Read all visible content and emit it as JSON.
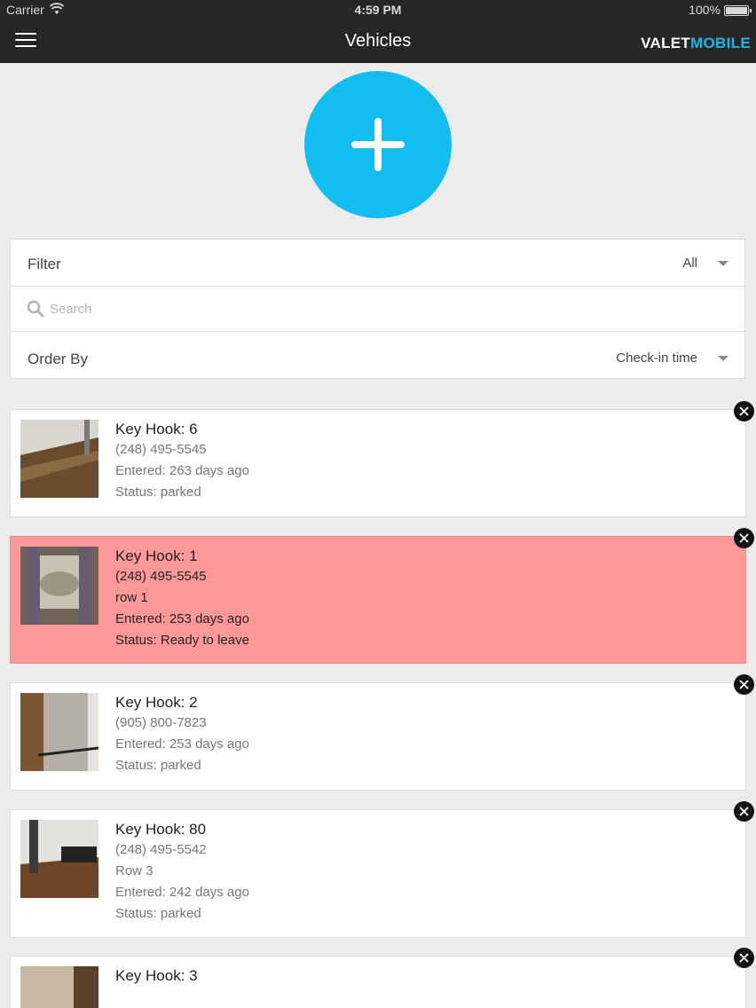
{
  "status_bar": {
    "carrier": "Carrier",
    "time": "4:59 PM",
    "battery": "100%"
  },
  "nav": {
    "title": "Vehicles",
    "brand_part1": "VALET",
    "brand_part2": "MOBILE",
    "brand_accent_color": "#16b9e8"
  },
  "add_button": {
    "color": "#12bdf0",
    "icon": "plus-icon"
  },
  "filter": {
    "label": "Filter",
    "value": "All"
  },
  "search": {
    "placeholder": "Search"
  },
  "order_by": {
    "label": "Order By",
    "value": "Check-in time"
  },
  "vehicles": [
    {
      "key_hook": "Key Hook: 6",
      "phone": "(248) 495-5545",
      "note": "",
      "entered": "Entered: 263 days ago",
      "status": "Status: parked",
      "highlight": false
    },
    {
      "key_hook": "Key Hook: 1",
      "phone": "(248) 495-5545",
      "note": "row 1",
      "entered": "Entered: 253 days ago",
      "status": "Status: Ready to leave",
      "highlight": true
    },
    {
      "key_hook": "Key Hook: 2",
      "phone": "(905) 800-7823",
      "note": "",
      "entered": "Entered: 253 days ago",
      "status": "Status: parked",
      "highlight": false
    },
    {
      "key_hook": "Key Hook: 80",
      "phone": "(248) 495-5542",
      "note": "Row 3",
      "entered": "Entered: 242 days ago",
      "status": "Status: parked",
      "highlight": false
    },
    {
      "key_hook": "Key Hook: 3"
    }
  ],
  "colors": {
    "highlight_row": "#ff9999",
    "navbar": "#262626"
  }
}
